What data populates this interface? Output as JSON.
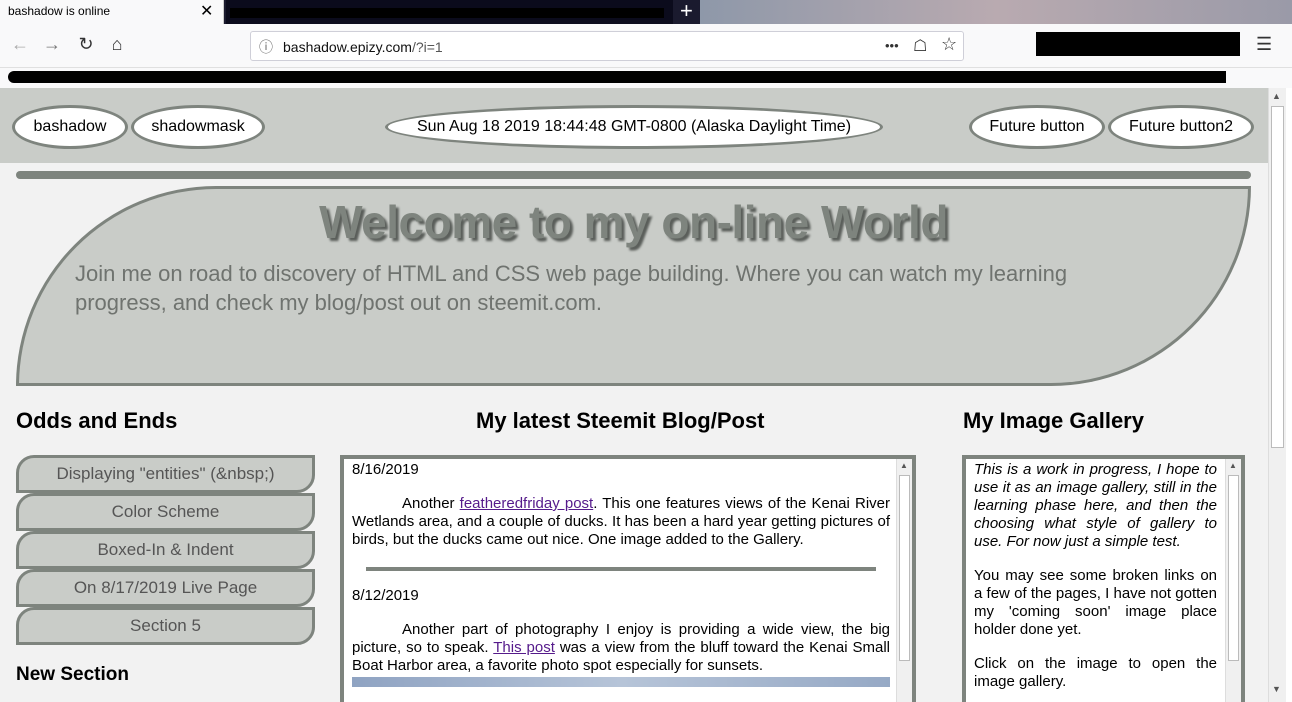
{
  "browser": {
    "tab_title": "bashadow is online",
    "tab_close": "✕",
    "new_tab": "+",
    "url_info_icon": "ⓘ",
    "url_domain": "bashadow.epizy.com",
    "url_path": "/?i=1",
    "url_more": "•••",
    "nav": {
      "back": "←",
      "forward": "→",
      "reload": "↻",
      "home": "⌂"
    },
    "pocket_icon": "☖",
    "bookmark_star": "☆",
    "menu": "☰"
  },
  "site_nav": {
    "left_buttons": [
      "bashadow",
      "shadowmask"
    ],
    "clock": "Sun Aug 18 2019 18:44:48 GMT-0800 (Alaska Daylight Time)",
    "right_buttons": [
      "Future button",
      "Future button2"
    ]
  },
  "welcome": {
    "title": "Welcome to my on-line World",
    "intro": "Join me on road to discovery of HTML and CSS web page building. Where you can watch my learning progress, and check my blog/post out on steemit.com."
  },
  "left_column": {
    "title": "Odds and Ends",
    "items": [
      "Displaying \"entities\" (&nbsp;)",
      "Color Scheme",
      "Boxed-In & Indent",
      "On 8/17/2019 Live Page",
      "Section 5"
    ],
    "new_section": "New Section"
  },
  "blog": {
    "title": "My latest Steemit Blog/Post",
    "posts": [
      {
        "date": "8/16/2019",
        "before": "Another ",
        "link": "featheredfriday post",
        "after": ". This one features views of the Kenai River Wetlands area, and a couple of ducks. It has been a hard year getting pictures of birds, but the ducks came out nice. One image added to the Gallery."
      },
      {
        "date": "8/12/2019",
        "before": "Another part of photography I enjoy is providing a wide view, the big picture, so to speak. ",
        "link": "This post",
        "after": " was a view from the bluff toward the Kenai Small Boat Harbor area, a favorite photo spot especially for sunsets."
      }
    ]
  },
  "gallery": {
    "title": "My Image Gallery",
    "paragraphs": [
      "This is a work in progress, I hope to use it as an image gallery, still in the learning phase here, and then the choosing what style of gallery to use. For now just a simple test.",
      "You may see some broken links on a few of the pages, I have not gotten my 'coming soon' image place holder done yet.",
      "Click on the image to open the image gallery."
    ]
  },
  "colors": {
    "frame": "#7e847e",
    "panel": "#c9ccc8",
    "link": "#551a8b"
  }
}
